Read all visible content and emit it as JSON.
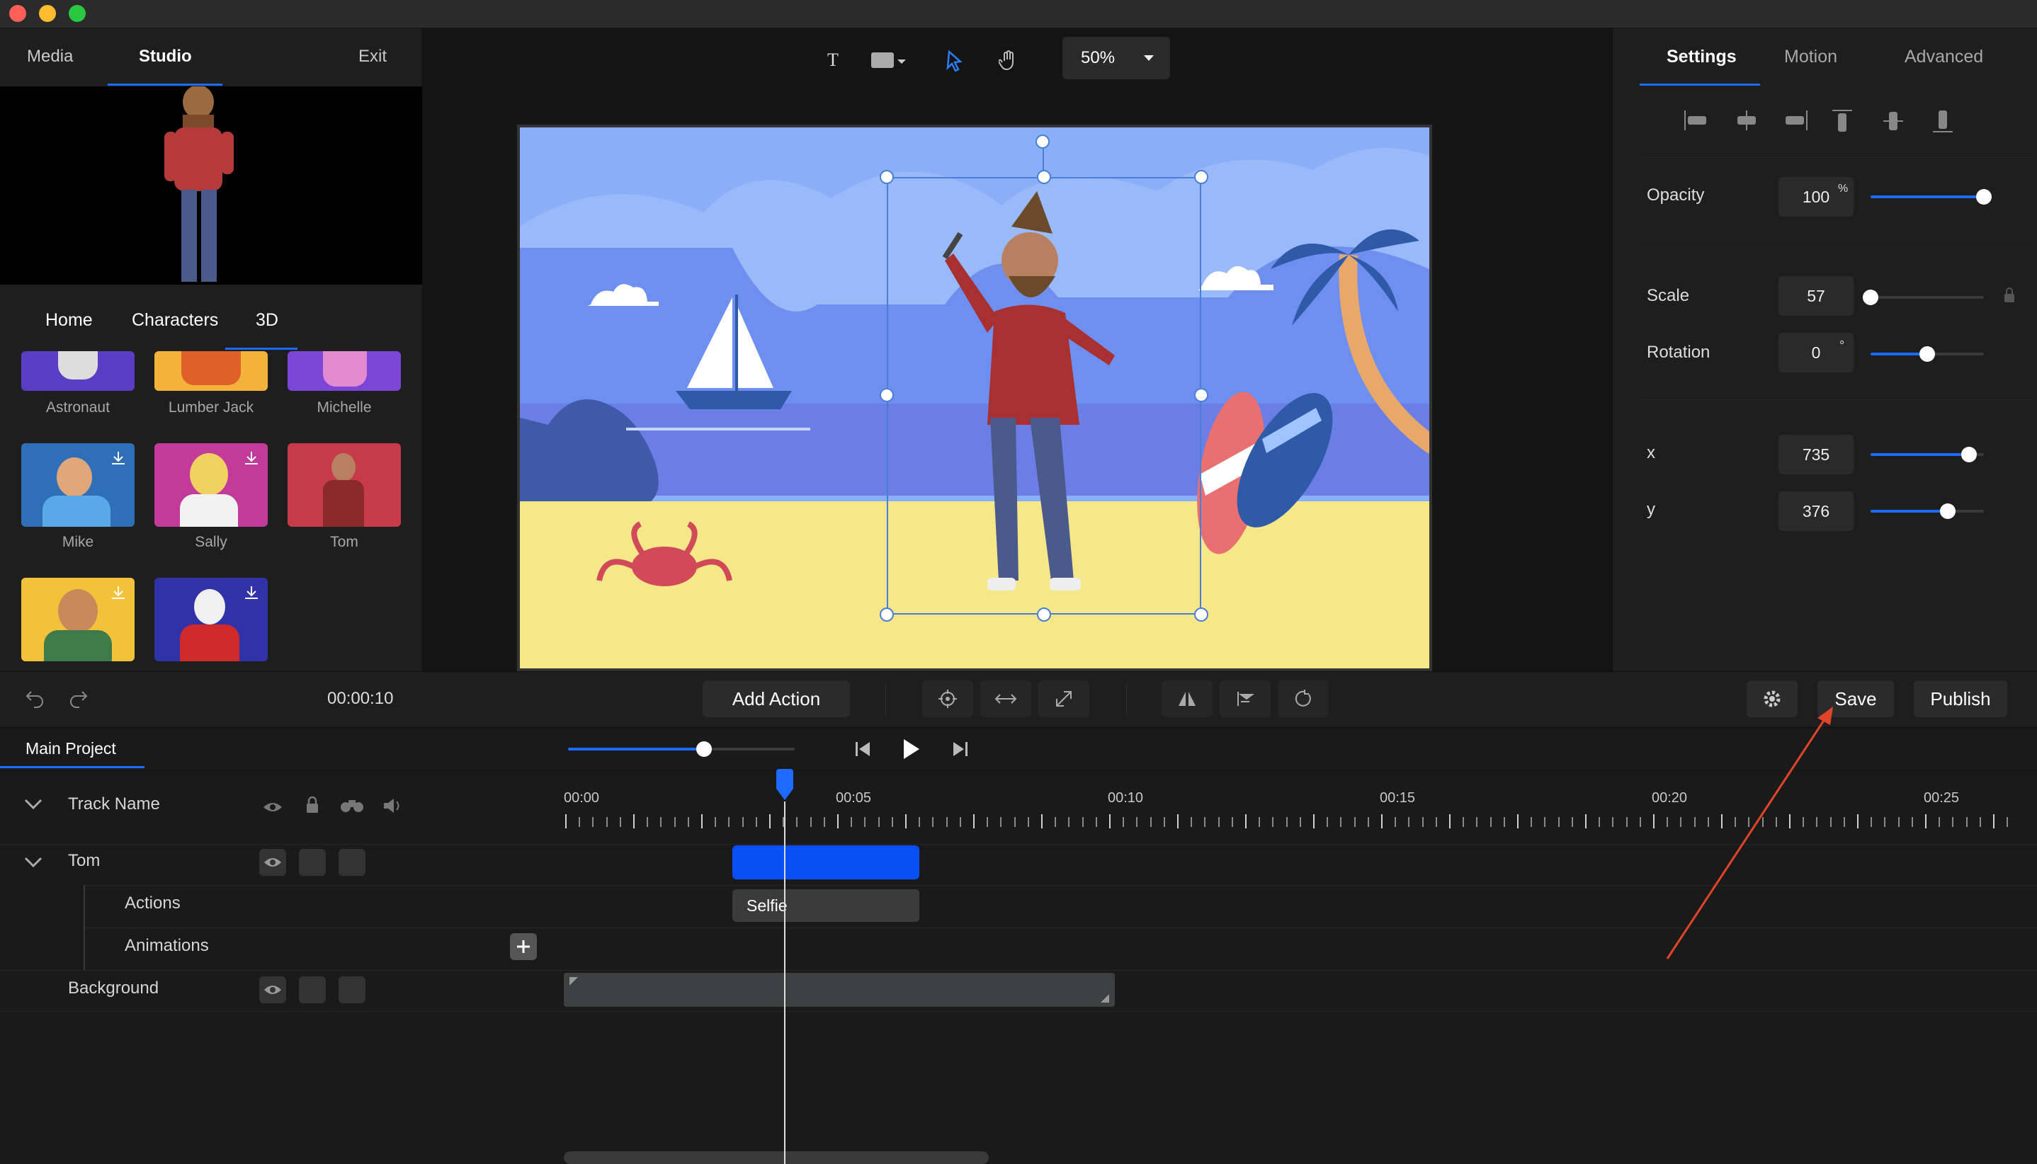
{
  "colors": {
    "accent": "#1e6bff",
    "arrow": "#e0452a",
    "sky": "#8aaef7",
    "sand": "#f6e889"
  },
  "left_panel": {
    "tabs": [
      "Media",
      "Studio",
      "Exit"
    ],
    "sub_tabs": [
      "Home",
      "Characters",
      "3D"
    ],
    "characters": [
      {
        "name": "Astronaut",
        "color": "#5b3dc4"
      },
      {
        "name": "Lumber Jack",
        "color": "#f3b33b"
      },
      {
        "name": "Michelle",
        "color": "#7b45d6"
      },
      {
        "name": "Mike",
        "color": "#2f6fb8"
      },
      {
        "name": "Sally",
        "color": "#c23a9a"
      },
      {
        "name": "Tom",
        "color": "#c63a4a"
      },
      {
        "name": "",
        "color": "#f3c23b"
      },
      {
        "name": "",
        "color": "#3232a8"
      }
    ]
  },
  "canvas_toolbar": {
    "text_tool": "T",
    "zoom": "50%"
  },
  "right_panel": {
    "tabs": [
      "Settings",
      "Motion",
      "Advanced"
    ],
    "opacity": {
      "label": "Opacity",
      "value": "100",
      "unit": "%",
      "level": 1.0
    },
    "scale": {
      "label": "Scale",
      "value": "57",
      "level": 0.0
    },
    "rotation": {
      "label": "Rotation",
      "value": "0",
      "unit": "°",
      "level": 0.5
    },
    "x": {
      "label": "x",
      "value": "735",
      "level": 0.87
    },
    "y": {
      "label": "y",
      "value": "376",
      "level": 0.68
    }
  },
  "toolbar": {
    "time": "00:00:10",
    "add_action": "Add Action",
    "save": "Save",
    "publish": "Publish"
  },
  "timeline": {
    "project_tab": "Main Project",
    "track_header": "Track Name",
    "tracks": {
      "tom": "Tom",
      "actions": "Actions",
      "animations": "Animations",
      "background": "Background"
    },
    "time_labels": [
      "00:00",
      "00:05",
      "00:10",
      "00:15",
      "00:20",
      "00:25"
    ],
    "clip_label": "Selfie",
    "volume_level": 0.6
  }
}
